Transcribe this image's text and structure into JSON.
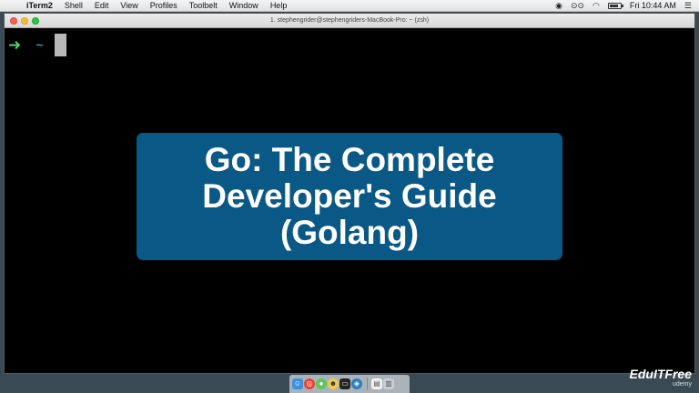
{
  "menubar": {
    "apple_icon": "apple-icon",
    "app_name": "iTerm2",
    "items": [
      "Shell",
      "Edit",
      "View",
      "Profiles",
      "Toolbelt",
      "Window",
      "Help"
    ],
    "status_icons": [
      "record-icon",
      "glasses-icon",
      "wifi-icon",
      "battery-icon"
    ],
    "clock": "Fri 10:44 AM",
    "list_icon": "list-icon"
  },
  "window": {
    "title": "1. stephengrider@stephengriders-MacBook-Pro: ~ (zsh)",
    "prompt_arrow": "➜",
    "prompt_dir": "~"
  },
  "overlay": {
    "lines": [
      "Go: The Complete",
      "Developer's Guide",
      "(Golang)"
    ],
    "background_color": "#0a5886"
  },
  "dock": {
    "icons": [
      "finder-icon",
      "chrome-icon",
      "messages-icon",
      "emoji-icon",
      "terminal-icon",
      "safari-icon",
      "document-icon",
      "trash-icon"
    ]
  },
  "watermark": {
    "main": "EduITFree",
    "sub": "udemy"
  }
}
